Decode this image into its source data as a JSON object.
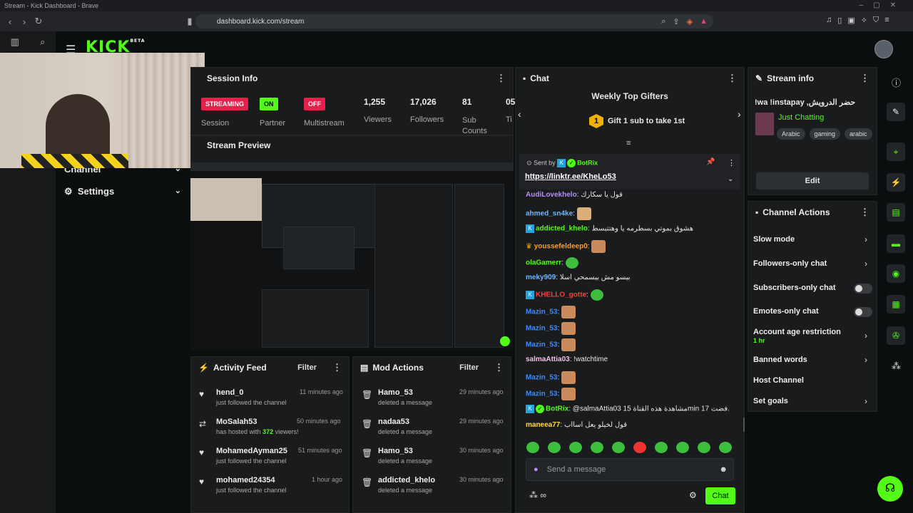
{
  "browser": {
    "title": "Stream - Kick Dashboard - Brave",
    "url": "dashboard.kick.com/stream"
  },
  "brand": {
    "logo": "KICK",
    "beta": "BETA",
    "accent": "#53fc18"
  },
  "nav": {
    "channel": "Channel",
    "settings": "Settings"
  },
  "session": {
    "title": "Session Info",
    "streaming": "STREAMING",
    "on": "ON",
    "off": "OFF",
    "session_label": "Session",
    "partner": "Partner",
    "multistream": "Multistream",
    "viewers": "1,255",
    "viewers_label": "Viewers",
    "followers": "17,026",
    "followers_label": "Followers",
    "subs": "81",
    "subs_label": "Sub Counts",
    "extra": "05",
    "extra_label": "Ti"
  },
  "preview": {
    "title": "Stream Preview"
  },
  "activity": {
    "title": "Activity Feed",
    "filter": "Filter",
    "items": [
      {
        "name": "hend_0",
        "desc": "just followed the channel",
        "time": "11 minutes ago"
      },
      {
        "name": "MoSalah53",
        "desc_pre": "has hosted with",
        "desc_num": "372",
        "desc_post": "viewers!",
        "time": "50 minutes ago"
      },
      {
        "name": "MohamedAyman25",
        "desc": "just followed the channel",
        "time": "51 minutes ago"
      },
      {
        "name": "mohamed24354",
        "desc": "just followed the channel",
        "time": "1 hour ago"
      }
    ]
  },
  "mod": {
    "title": "Mod Actions",
    "filter": "Filter",
    "items": [
      {
        "name": "Hamo_53",
        "desc": "deleted a message",
        "time": "29 minutes ago"
      },
      {
        "name": "nadaa53",
        "desc": "deleted a message",
        "time": "29 minutes ago"
      },
      {
        "name": "Hamo_53",
        "desc": "deleted a message",
        "time": "30 minutes ago"
      },
      {
        "name": "addicted_khelo",
        "desc": "deleted a message",
        "time": "30 minutes ago"
      }
    ]
  },
  "chat": {
    "title": "Chat",
    "gifters_title": "Weekly Top Gifters",
    "gift_rank": "1",
    "gift_text": "Gift 1 sub to take 1st",
    "pinned_by": "Sent by",
    "pinned_user": "BotRix",
    "pinned_link": "https://linktr.ee/KheLo53",
    "messages": [
      {
        "user": "AudiLovekhelo",
        "text": "قول يا سكارك",
        "color": "#b78cff"
      },
      {
        "user": "ahmed_sn4ke",
        "text": "",
        "color": "#6fb6ff"
      },
      {
        "user": "addicted_khelo",
        "text": "هشوق بموتي بسطرمه يا وهتتبسط",
        "color": "#53fc18"
      },
      {
        "user": "youssefeldeep0",
        "text": "",
        "color": "#ff9f1c"
      },
      {
        "user": "olaGamerr",
        "text": "",
        "color": "#53fc18"
      },
      {
        "user": "meky909",
        "text": "بيسو مش بيسمحي اسلا",
        "color": "#6fb6ff"
      },
      {
        "user": "KHELLO_gotte",
        "text": "",
        "color": "#ff3b3b"
      },
      {
        "user": "Mazin_53",
        "text": "",
        "color": "#3d8bff"
      },
      {
        "user": "Mazin_53",
        "text": "",
        "color": "#3d8bff"
      },
      {
        "user": "Mazin_53",
        "text": "",
        "color": "#3d8bff"
      },
      {
        "user": "salmaAttia03",
        "text": "!watchtime",
        "color": "#f0c0e0"
      },
      {
        "user": "Mazin_53",
        "text": "",
        "color": "#3d8bff"
      },
      {
        "user": "Mazin_53",
        "text": "",
        "color": "#3d8bff"
      },
      {
        "user": "BotRix",
        "text": "@salmaAttia03 مشاهدة هذه القناة 15min فضت 17.",
        "color": "#53fc18"
      },
      {
        "user": "maneea77",
        "text": "قول لخيلو يعل اسااب",
        "color": "#ffd84a"
      }
    ],
    "placeholder": "Send a message",
    "send": "Chat"
  },
  "streaminfo": {
    "title": "Stream info",
    "stream_title": "!wa !instapay ,حضر الدرويش",
    "category": "Just Chatting",
    "tags": [
      "Arabic",
      "gaming",
      "arabic"
    ],
    "edit": "Edit"
  },
  "actions": {
    "title": "Channel Actions",
    "slow": "Slow mode",
    "followers": "Followers-only chat",
    "subs": "Subscribers-only chat",
    "emotes": "Emotes-only chat",
    "age": "Account age restriction",
    "age_val": "1 hr",
    "banned": "Banned words",
    "host": "Host Channel",
    "goals": "Set goals"
  }
}
